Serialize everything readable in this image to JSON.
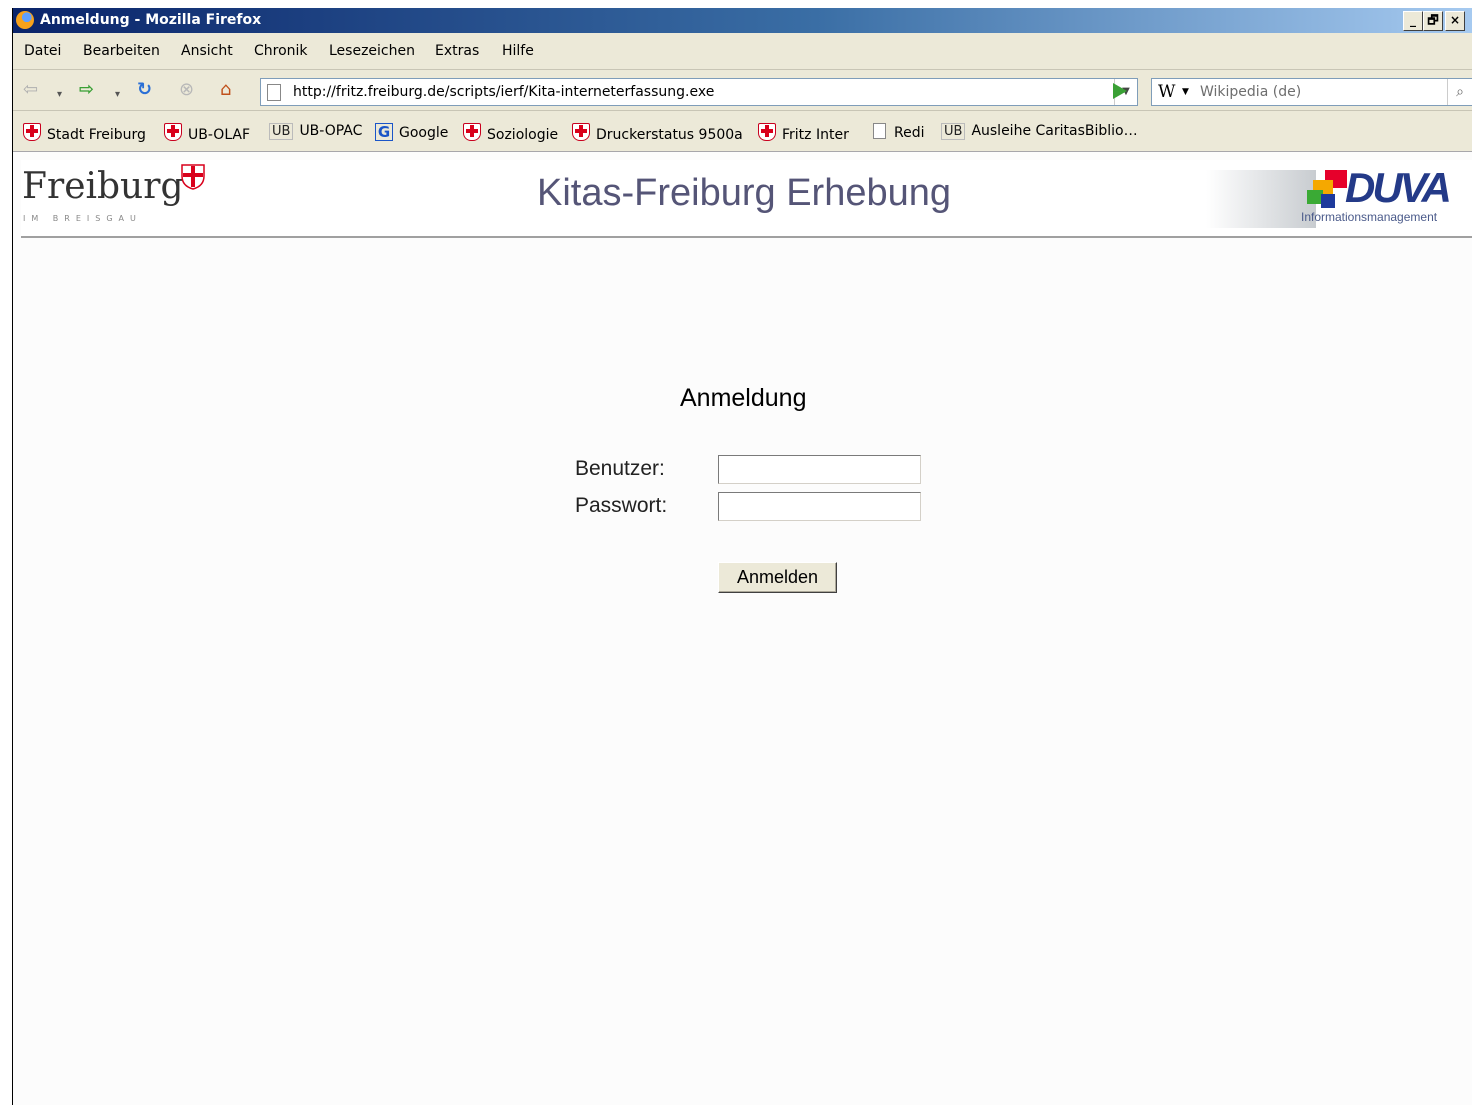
{
  "window": {
    "title": "Anmeldung - Mozilla Firefox",
    "minimize": "_",
    "restore": "🗗",
    "close": "×"
  },
  "menu": [
    "Datei",
    "Bearbeiten",
    "Ansicht",
    "Chronik",
    "Lesezeichen",
    "Extras",
    "Hilfe"
  ],
  "nav": {
    "url": "http://fritz.freiburg.de/scripts/ierf/Kita-interneterfassung.exe",
    "search_engine_icon": "W",
    "search_placeholder": "Wikipedia (de)",
    "icons": [
      "back-icon",
      "forward-icon",
      "reload-icon",
      "stop-icon",
      "home-icon"
    ]
  },
  "bookmarks": [
    {
      "label": "Stadt Freiburg",
      "icon": "freiburg-cross-icon"
    },
    {
      "label": "UB-OLAF",
      "icon": "freiburg-cross-icon"
    },
    {
      "label": "UB-OPAC",
      "icon": "ub-icon",
      "icon_text": "UB"
    },
    {
      "label": "Google",
      "icon": "google-icon",
      "icon_text": "G"
    },
    {
      "label": "Soziologie",
      "icon": "freiburg-cross-icon"
    },
    {
      "label": "Druckerstatus 9500a",
      "icon": "freiburg-cross-icon"
    },
    {
      "label": "Fritz Inter",
      "icon": "freiburg-cross-icon"
    },
    {
      "label": "Redi",
      "icon": "page-icon"
    },
    {
      "label": "Ausleihe CaritasBiblio…",
      "icon": "ub-icon",
      "icon_text": "UB"
    }
  ],
  "page": {
    "logo_text": "Freiburg",
    "logo_sub": "IM BREISGAU",
    "header_title": "Kitas-Freiburg Erhebung",
    "duva_logo": "DUVA",
    "duva_sub": "Informationsmanagement",
    "login_title": "Anmeldung",
    "user_label": "Benutzer:",
    "user_value": "",
    "password_label": "Passwort:",
    "password_value": "",
    "submit_label": "Anmelden"
  },
  "colors": {
    "titlebar": "#0a246a",
    "header_title": "#555577",
    "duva_blue": "#243a88",
    "freiburg_red": "#d9001b"
  }
}
